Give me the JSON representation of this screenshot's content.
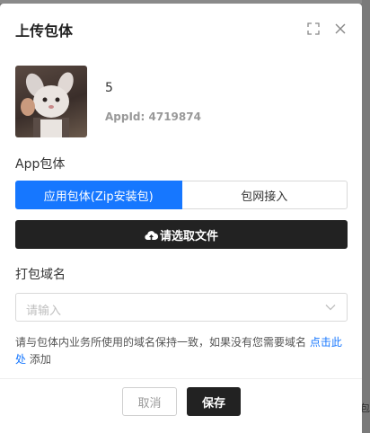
{
  "modal": {
    "title": "上传包体",
    "expand_icon": "expand-icon",
    "close_icon": "close-icon"
  },
  "app": {
    "name": "5",
    "app_id": "AppId: 4719874"
  },
  "package_section": {
    "label": "App包体",
    "tabs": [
      {
        "label": "应用包体(Zip安装包)",
        "active": true
      },
      {
        "label": "包网接入",
        "active": false
      }
    ],
    "select_file_label": "请选取文件",
    "select_file_icon": "cloud-upload-icon"
  },
  "domain_section": {
    "label": "打包域名",
    "placeholder": "请输入",
    "hint_prefix": "请与包体内业务所使用的域名保持一致，如果没有您需要域名 ",
    "hint_link": "点击此处",
    "hint_suffix": " 添加"
  },
  "footer": {
    "cancel_label": "取消",
    "save_label": "保存"
  },
  "background": {
    "partial_text": "包"
  },
  "colors": {
    "primary": "#1677ff",
    "dark_button": "#222222"
  }
}
